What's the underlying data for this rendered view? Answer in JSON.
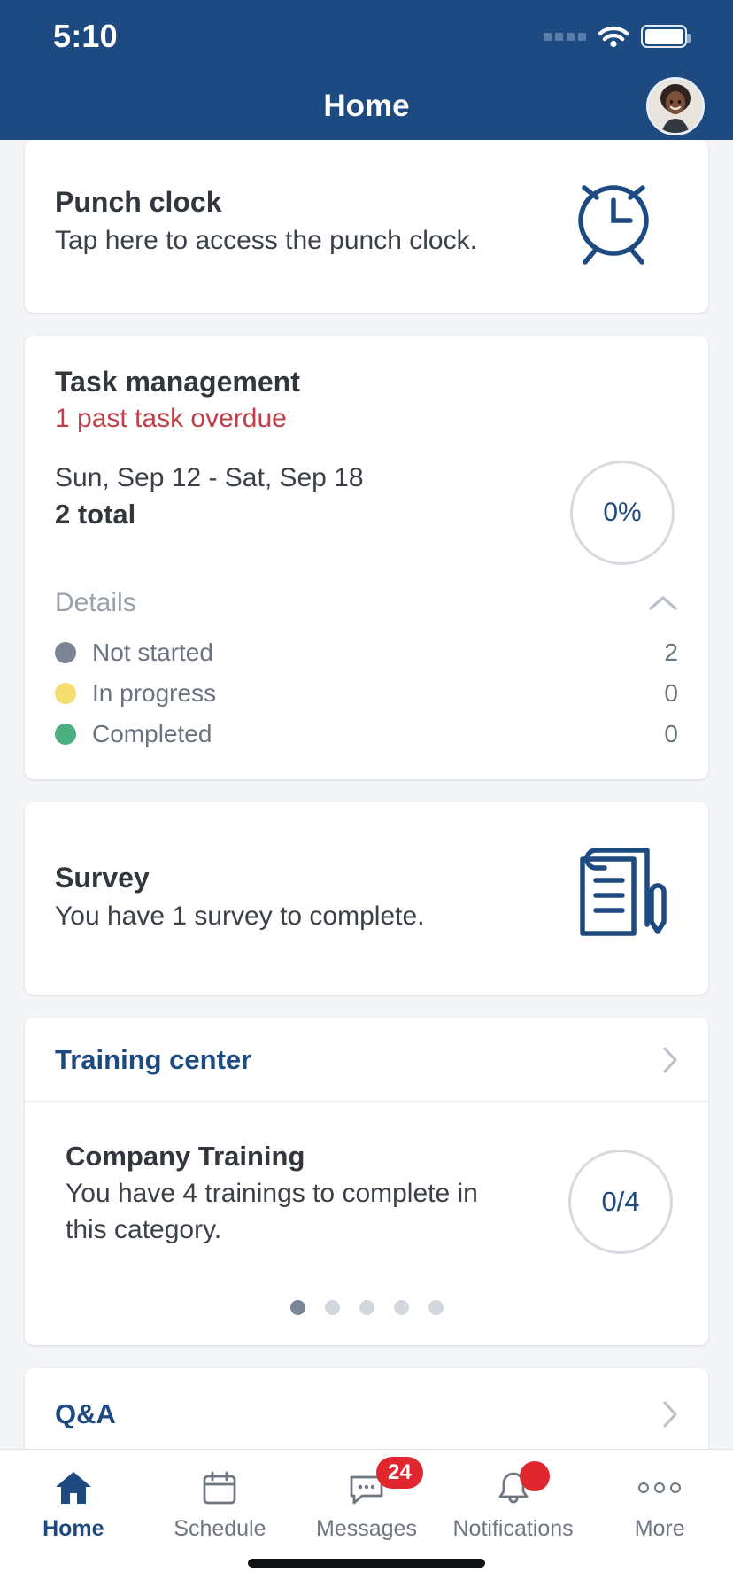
{
  "status_bar": {
    "time": "5:10",
    "cellular_icon": "cellular-bars-icon",
    "wifi_icon": "wifi-icon",
    "battery_icon": "battery-full-icon"
  },
  "nav": {
    "title": "Home",
    "avatar_icon": "user-avatar"
  },
  "colors": {
    "brand_blue": "#1d4a80",
    "overdue_red": "#c0404a",
    "badge_red": "#e0262e",
    "not_started_dot": "#7b8595",
    "in_progress_dot": "#f5dd6e",
    "completed_dot": "#4caf80",
    "page_bg": "#f4f5f7"
  },
  "cards": {
    "punch_clock": {
      "title": "Punch clock",
      "subtitle": "Tap here to access the punch clock.",
      "icon": "alarm-clock-icon"
    },
    "task_management": {
      "title": "Task management",
      "overdue": "1 past task overdue",
      "date_range": "Sun, Sep 12 - Sat, Sep 18",
      "total": "2 total",
      "percent": "0%",
      "details_label": "Details",
      "collapse_icon": "chevron-up-icon",
      "statuses": [
        {
          "label": "Not started",
          "value": "2",
          "color": "#7b8595"
        },
        {
          "label": "In progress",
          "value": "0",
          "color": "#f5dd6e"
        },
        {
          "label": "Completed",
          "value": "0",
          "color": "#4caf80"
        }
      ]
    },
    "survey": {
      "title": "Survey",
      "subtitle": "You have 1 survey to complete.",
      "icon": "survey-document-icon"
    },
    "training_center": {
      "header": "Training center",
      "header_icon": "chevron-right-icon",
      "item_title": "Company Training",
      "item_subtitle": "You have 4 trainings to complete in this category.",
      "progress": "0/4",
      "pager_total": 5,
      "pager_active_index": 0
    },
    "qa": {
      "title": "Q&A",
      "icon": "chevron-right-icon"
    }
  },
  "tabbar": {
    "items": [
      {
        "label": "Home",
        "icon": "home-icon",
        "active": true,
        "badge": ""
      },
      {
        "label": "Schedule",
        "icon": "calendar-icon",
        "active": false,
        "badge": ""
      },
      {
        "label": "Messages",
        "icon": "chat-bubble-icon",
        "active": false,
        "badge": "24"
      },
      {
        "label": "Notifications",
        "icon": "bell-icon",
        "active": false,
        "badge": "dot"
      },
      {
        "label": "More",
        "icon": "ellipsis-icon",
        "active": false,
        "badge": ""
      }
    ]
  }
}
